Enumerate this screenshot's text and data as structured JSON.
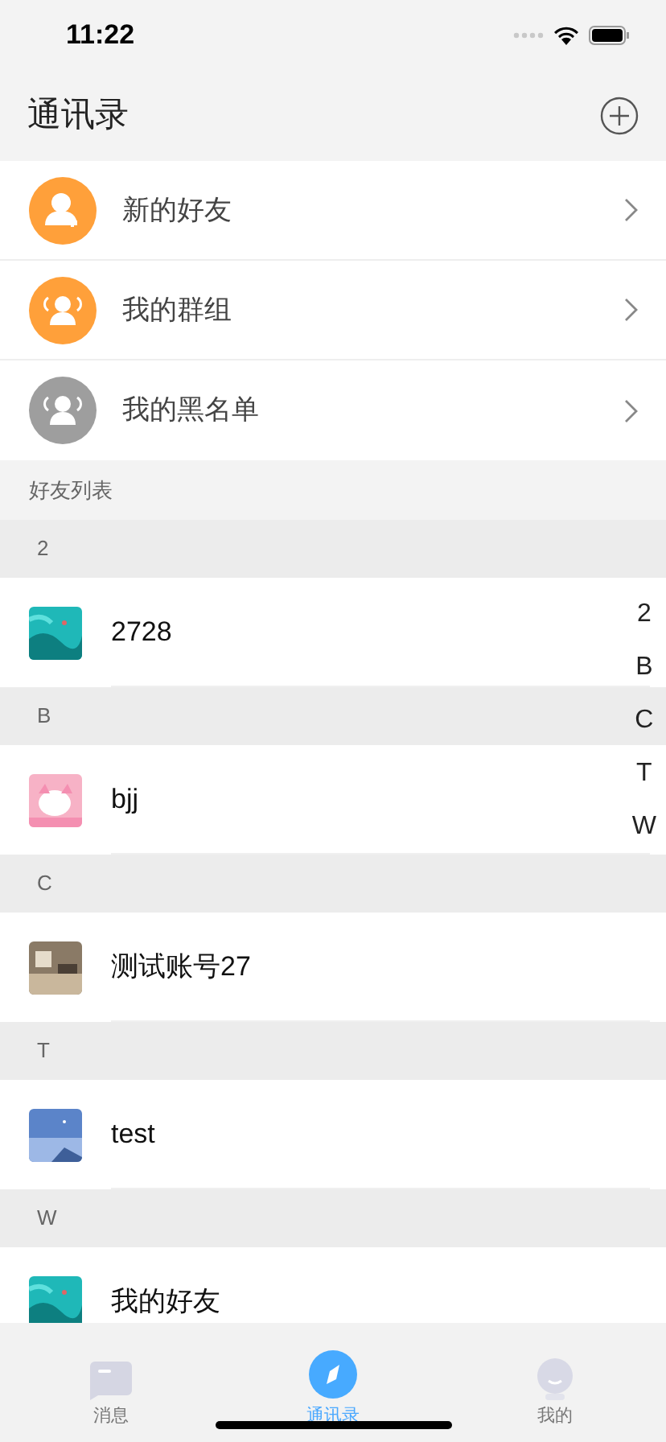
{
  "status_bar": {
    "time": "11:22"
  },
  "header": {
    "title": "通讯录"
  },
  "menu": [
    {
      "label": "新的好友",
      "kind": "add-person",
      "color": "#ffa03a"
    },
    {
      "label": "我的群组",
      "kind": "group",
      "color": "#ffa03a"
    },
    {
      "label": "我的黑名单",
      "kind": "group",
      "color": "#9e9e9e"
    }
  ],
  "list_label": "好友列表",
  "sections": [
    {
      "letter": "2",
      "contacts": [
        {
          "name": "2728"
        }
      ]
    },
    {
      "letter": "B",
      "contacts": [
        {
          "name": "bjj"
        }
      ]
    },
    {
      "letter": "C",
      "contacts": [
        {
          "name": "测试账号27"
        }
      ]
    },
    {
      "letter": "T",
      "contacts": [
        {
          "name": "test"
        }
      ]
    },
    {
      "letter": "W",
      "contacts": [
        {
          "name": "我的好友"
        }
      ]
    }
  ],
  "index": [
    "2",
    "B",
    "C",
    "T",
    "W"
  ],
  "tabs": [
    {
      "label": "消息",
      "kind": "chat",
      "selected": false
    },
    {
      "label": "通讯录",
      "kind": "contacts",
      "selected": true
    },
    {
      "label": "我的",
      "kind": "me",
      "selected": false
    }
  ]
}
